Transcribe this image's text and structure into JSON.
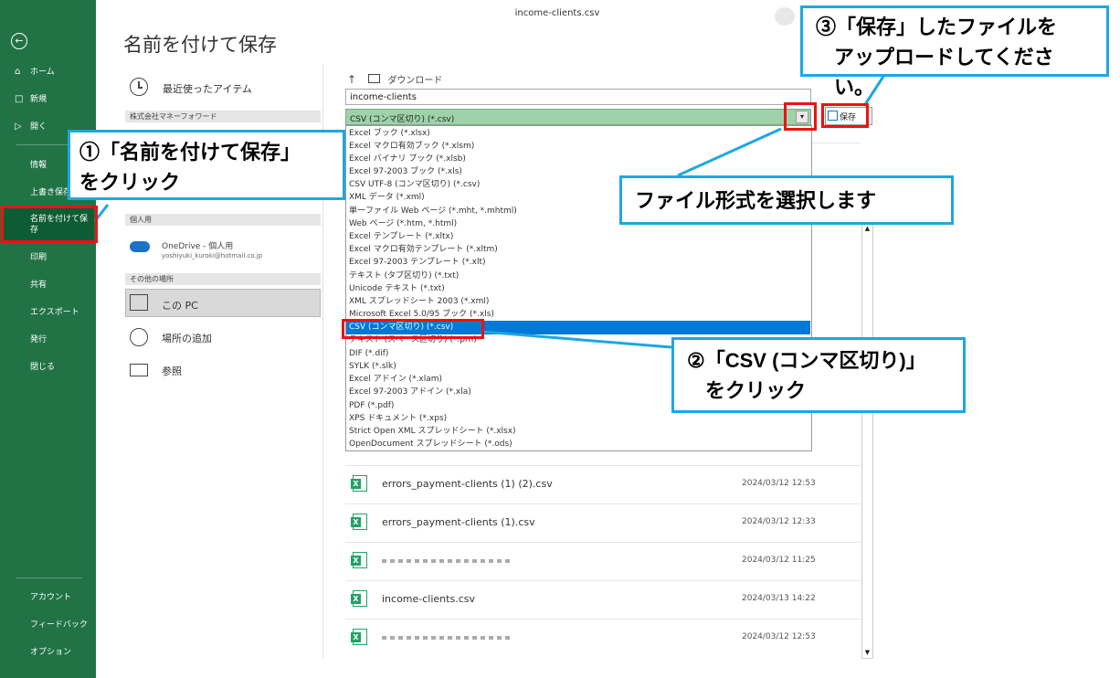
{
  "window_title": "income-clients.csv",
  "page_title": "名前を付けて保存",
  "nav": {
    "back": "←",
    "items": [
      {
        "icon": "⌂",
        "label": "ホーム"
      },
      {
        "icon": "□",
        "label": "新規"
      },
      {
        "icon": "▷",
        "label": "開く"
      },
      {
        "label": "情報"
      },
      {
        "label": "上書き保存"
      },
      {
        "label": "名前を付けて保存"
      },
      {
        "label": "印刷"
      },
      {
        "label": "共有"
      },
      {
        "label": "エクスポート"
      },
      {
        "label": "発行"
      },
      {
        "label": "閉じる"
      }
    ],
    "bottom": [
      "アカウント",
      "フィードバック",
      "オプション"
    ]
  },
  "locations": {
    "recent": "最近使ったアイテム",
    "org_header": "株式会社マネーフォワード",
    "personal_header": "個人用",
    "onedrive_name": "OneDrive - 個人用",
    "onedrive_email": "yoshiyuki_kuroki@hotmail.co.jp",
    "other_header": "その他の場所",
    "this_pc": "この PC",
    "add_place": "場所の追加",
    "browse": "参照"
  },
  "path": {
    "up": "↑",
    "folder": "ダウンロード"
  },
  "filename_value": "income-clients",
  "filetype_value": "CSV (コンマ区切り) (*.csv)",
  "save_label": "保存",
  "filetype_options": [
    "Excel ブック (*.xlsx)",
    "Excel マクロ有効ブック (*.xlsm)",
    "Excel バイナリ ブック (*.xlsb)",
    "Excel 97-2003 ブック (*.xls)",
    "CSV UTF-8 (コンマ区切り) (*.csv)",
    "XML データ (*.xml)",
    "単一ファイル Web ページ (*.mht, *.mhtml)",
    "Web ページ (*.htm, *.html)",
    "Excel テンプレート (*.xltx)",
    "Excel マクロ有効テンプレート (*.xltm)",
    "Excel 97-2003 テンプレート (*.xlt)",
    "テキスト (タブ区切り) (*.txt)",
    "Unicode テキスト (*.txt)",
    "XML スプレッドシート 2003 (*.xml)",
    "Microsoft Excel 5.0/95 ブック (*.xls)",
    "CSV (コンマ区切り) (*.csv)",
    "テキスト (スペース区切り) (*.prn)",
    "DIF (*.dif)",
    "SYLK (*.slk)",
    "Excel アドイン (*.xlam)",
    "Excel 97-2003 アドイン (*.xla)",
    "PDF (*.pdf)",
    "XPS ドキュメント (*.xps)",
    "Strict Open XML スプレッドシート (*.xlsx)",
    "OpenDocument スプレッドシート (*.ods)"
  ],
  "files": [
    {
      "name": "errors_payment-clients (1) (2).csv",
      "date": "2024/03/12 12:53"
    },
    {
      "name": "errors_payment-clients (1).csv",
      "date": "2024/03/12 12:33"
    },
    {
      "name": "",
      "date": "2024/03/12 11:25"
    },
    {
      "name": "income-clients.csv",
      "date": "2024/03/13 14:22"
    },
    {
      "name": "",
      "date": "2024/03/12 12:53"
    }
  ],
  "callouts": {
    "c1_line1": "①「名前を付けて保存」",
    "c1_line2": "をクリック",
    "c2": "ファイル形式を選択します",
    "c3_line1": "②「CSV (コンマ区切り)」",
    "c3_line2": "をクリック",
    "c4_line1": "③「保存」したファイルを",
    "c4_line2": "アップロードしてください。"
  },
  "colors": {
    "nav": "#217346",
    "callout_border": "#1ea7e1",
    "highlight_red": "#e11111",
    "selected": "#0078d7"
  }
}
